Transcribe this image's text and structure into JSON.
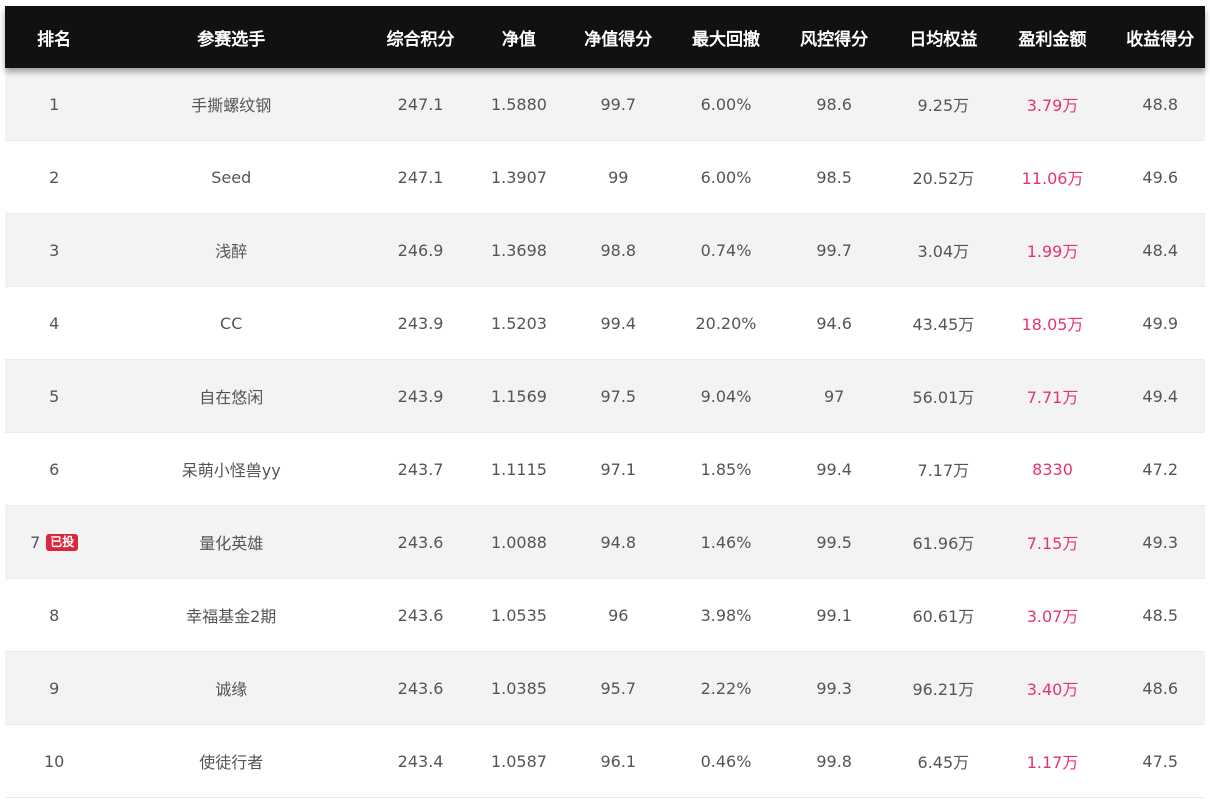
{
  "headers": [
    "排名",
    "参赛选手",
    "综合积分",
    "净值",
    "净值得分",
    "最大回撤",
    "风控得分",
    "日均权益",
    "盈利金额",
    "收益得分"
  ],
  "rows": [
    {
      "rank": "1",
      "badge": "",
      "name": "手撕螺纹钢",
      "score": "247.1",
      "nav": "1.5880",
      "nav_score": "99.7",
      "max_drawdown": "6.00%",
      "risk_score": "98.6",
      "daily_equity": "9.25万",
      "profit": "3.79万",
      "return_score": "48.8"
    },
    {
      "rank": "2",
      "badge": "",
      "name": "Seed",
      "score": "247.1",
      "nav": "1.3907",
      "nav_score": "99",
      "max_drawdown": "6.00%",
      "risk_score": "98.5",
      "daily_equity": "20.52万",
      "profit": "11.06万",
      "return_score": "49.6"
    },
    {
      "rank": "3",
      "badge": "",
      "name": "浅醉",
      "score": "246.9",
      "nav": "1.3698",
      "nav_score": "98.8",
      "max_drawdown": "0.74%",
      "risk_score": "99.7",
      "daily_equity": "3.04万",
      "profit": "1.99万",
      "return_score": "48.4"
    },
    {
      "rank": "4",
      "badge": "",
      "name": "CC",
      "score": "243.9",
      "nav": "1.5203",
      "nav_score": "99.4",
      "max_drawdown": "20.20%",
      "risk_score": "94.6",
      "daily_equity": "43.45万",
      "profit": "18.05万",
      "return_score": "49.9"
    },
    {
      "rank": "5",
      "badge": "",
      "name": "自在悠闲",
      "score": "243.9",
      "nav": "1.1569",
      "nav_score": "97.5",
      "max_drawdown": "9.04%",
      "risk_score": "97",
      "daily_equity": "56.01万",
      "profit": "7.71万",
      "return_score": "49.4"
    },
    {
      "rank": "6",
      "badge": "",
      "name": "呆萌小怪兽yy",
      "score": "243.7",
      "nav": "1.1115",
      "nav_score": "97.1",
      "max_drawdown": "1.85%",
      "risk_score": "99.4",
      "daily_equity": "7.17万",
      "profit": "8330",
      "return_score": "47.2"
    },
    {
      "rank": "7",
      "badge": "已投",
      "name": "量化英雄",
      "score": "243.6",
      "nav": "1.0088",
      "nav_score": "94.8",
      "max_drawdown": "1.46%",
      "risk_score": "99.5",
      "daily_equity": "61.96万",
      "profit": "7.15万",
      "return_score": "49.3"
    },
    {
      "rank": "8",
      "badge": "",
      "name": "幸福基金2期",
      "score": "243.6",
      "nav": "1.0535",
      "nav_score": "96",
      "max_drawdown": "3.98%",
      "risk_score": "99.1",
      "daily_equity": "60.61万",
      "profit": "3.07万",
      "return_score": "48.5"
    },
    {
      "rank": "9",
      "badge": "",
      "name": "诚缘",
      "score": "243.6",
      "nav": "1.0385",
      "nav_score": "95.7",
      "max_drawdown": "2.22%",
      "risk_score": "99.3",
      "daily_equity": "96.21万",
      "profit": "3.40万",
      "return_score": "48.6"
    },
    {
      "rank": "10",
      "badge": "",
      "name": "使徒行者",
      "score": "243.4",
      "nav": "1.0587",
      "nav_score": "96.1",
      "max_drawdown": "0.46%",
      "risk_score": "99.8",
      "daily_equity": "6.45万",
      "profit": "1.17万",
      "return_score": "47.5"
    }
  ],
  "colors": {
    "header_bg": "#111111",
    "header_text": "#ffffff",
    "profit": "#e8336d",
    "badge_bg": "#d9283b",
    "row_alt": "#f3f3f3"
  }
}
